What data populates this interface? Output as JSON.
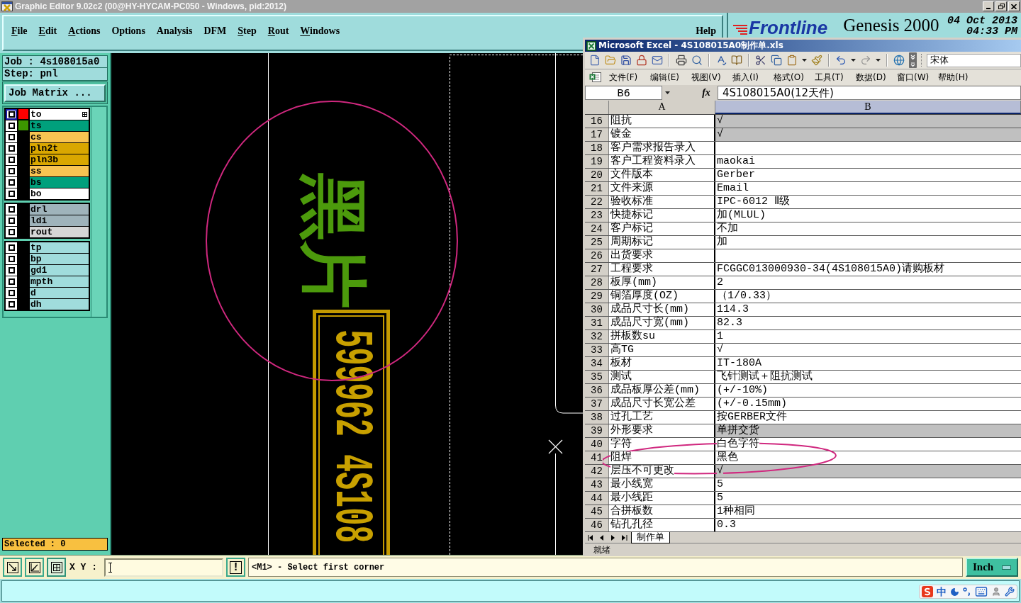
{
  "window": {
    "title": "Graphic Editor 9.02c2 (00@HY-HYCAM-PC050 - Windows, pid:2012)"
  },
  "menu": [
    {
      "label": "File",
      "mnemonic": true
    },
    {
      "label": "Edit",
      "mnemonic": true
    },
    {
      "label": "Actions",
      "mnemonic": true
    },
    {
      "label": "Options",
      "mnemonic": false
    },
    {
      "label": "Analysis",
      "mnemonic": false
    },
    {
      "label": "DFM",
      "mnemonic": false
    },
    {
      "label": "Step",
      "mnemonic": true
    },
    {
      "label": "Rout",
      "mnemonic": true
    },
    {
      "label": "Windows",
      "mnemonic": true
    },
    {
      "label": "Help",
      "mnemonic": false
    }
  ],
  "branding": {
    "logo": "Frontline",
    "product": "Genesis 2000",
    "date": "04 Oct 2013",
    "time": "04:33 PM"
  },
  "job": {
    "job_label": "Job : 4s108015a0",
    "step_label": "Step: pnl",
    "matrix_button": "Job Matrix ..."
  },
  "layer_groups": [
    {
      "layers": [
        {
          "name": "to",
          "color": "#ffffff",
          "swatch": {
            "color": "#ff0000"
          },
          "checked": true,
          "work_layer": true
        },
        {
          "name": "ts",
          "color": "#00a07c",
          "swatch": {
            "color": "#3c9600"
          },
          "checked": true,
          "work_layer": false
        },
        {
          "name": "cs",
          "color": "#f8c452",
          "checked": true,
          "work_layer": false
        },
        {
          "name": "pln2t",
          "color": "#d9a700",
          "checked": true,
          "work_layer": false
        },
        {
          "name": "pln3b",
          "color": "#d9a700",
          "checked": true,
          "work_layer": false
        },
        {
          "name": "ss",
          "color": "#f8c452",
          "checked": true,
          "work_layer": false
        },
        {
          "name": "bs",
          "color": "#00a07c",
          "checked": true,
          "work_layer": false
        },
        {
          "name": "bo",
          "color": "#ffffff",
          "checked": true,
          "work_layer": false
        }
      ]
    },
    {
      "layers": [
        {
          "name": "drl",
          "color": "#9fb3bb",
          "checked": true,
          "work_layer": false
        },
        {
          "name": "ldi",
          "color": "#9fb3bb",
          "checked": true,
          "work_layer": false
        },
        {
          "name": "rout",
          "color": "#d6d6d6",
          "checked": true,
          "work_layer": false
        }
      ]
    },
    {
      "layers": [
        {
          "name": "tp",
          "color": "#a0dcdc",
          "checked": true,
          "work_layer": false
        },
        {
          "name": "bp",
          "color": "#a0dcdc",
          "checked": true,
          "work_layer": false
        },
        {
          "name": "gd1",
          "color": "#a0dcdc",
          "checked": true,
          "work_layer": false
        },
        {
          "name": "mpth",
          "color": "#a0dcdc",
          "checked": true,
          "work_layer": false
        },
        {
          "name": "d",
          "color": "#a0dcdc",
          "checked": true,
          "work_layer": false
        },
        {
          "name": "dh",
          "color": "#a0dcdc",
          "checked": true,
          "work_layer": false
        }
      ]
    }
  ],
  "selection": {
    "label": "Selected : 0"
  },
  "canvas": {
    "silkscreen_text": "黑片",
    "serial_text": "599962 4S108"
  },
  "command_bar": {
    "xy_label": "X Y :",
    "alert_button": "!",
    "prompt": "<M1> - Select first corner",
    "units_button": "Inch"
  },
  "ime": {
    "mode": "中"
  },
  "excel": {
    "title": "Microsoft Excel - 4S108015A0制作单.xls",
    "font": "宋体",
    "menu": [
      "文件(F)",
      "编辑(E)",
      "视图(V)",
      "插入(I)",
      "格式(O)",
      "工具(T)",
      "数据(D)",
      "窗口(W)",
      "帮助(H)"
    ],
    "name_box": "B6",
    "function_button": "fx",
    "formula": "4S108015A0(12天件)",
    "columns": [
      {
        "label": "A",
        "selected": false
      },
      {
        "label": "B",
        "selected": true
      }
    ],
    "rows": [
      {
        "number": "16",
        "a": "阻抗",
        "b": "√",
        "shaded": true
      },
      {
        "number": "17",
        "a": "镀金",
        "b": "√",
        "shaded": true
      },
      {
        "number": "18",
        "a": "客户需求报告录入",
        "shaded": false
      },
      {
        "number": "19",
        "a": "客户工程资料录入",
        "b": "maokai",
        "shaded": false
      },
      {
        "number": "20",
        "a": "文件版本",
        "b": "Gerber",
        "shaded": false
      },
      {
        "number": "21",
        "a": "文件来源",
        "b": "Email",
        "shaded": false
      },
      {
        "number": "22",
        "a": "验收标准",
        "b": "IPC-6012 Ⅱ级",
        "shaded": false
      },
      {
        "number": "23",
        "a": "快捷标记",
        "b": "加(MLUL)",
        "shaded": false
      },
      {
        "number": "24",
        "a": "客户标记",
        "b": "不加",
        "shaded": false
      },
      {
        "number": "25",
        "a": "周期标记",
        "b": "加",
        "shaded": false
      },
      {
        "number": "26",
        "a": "出货要求",
        "shaded": false
      },
      {
        "number": "27",
        "a": "工程要求",
        "b": "FCGGC013000930-34(4S108015A0)请购板材",
        "shaded": false
      },
      {
        "number": "28",
        "a": "板厚(mm)",
        "b": "2",
        "shaded": false
      },
      {
        "number": "29",
        "a": "铜箔厚度(OZ)",
        "b": "（1/0.33）",
        "shaded": false
      },
      {
        "number": "30",
        "a": "成品尺寸长(mm)",
        "b": "114.3",
        "shaded": false
      },
      {
        "number": "31",
        "a": "成品尺寸宽(mm)",
        "b": "82.3",
        "shaded": false
      },
      {
        "number": "32",
        "a": "拼板数su",
        "b": "1",
        "shaded": false
      },
      {
        "number": "33",
        "a": "高TG",
        "b": "√",
        "shaded": false
      },
      {
        "number": "34",
        "a": "板材",
        "b": "IT-180A",
        "shaded": false
      },
      {
        "number": "35",
        "a": "测试",
        "b": "飞针测试＋阻抗测试",
        "shaded": false
      },
      {
        "number": "36",
        "a": "成品板厚公差(mm)",
        "b": "(+/-10%)",
        "shaded": false
      },
      {
        "number": "37",
        "a": "成品尺寸长宽公差",
        "b": "(+/-0.15mm)",
        "shaded": false
      },
      {
        "number": "38",
        "a": "过孔工艺",
        "b": "按GERBER文件",
        "shaded": false
      },
      {
        "number": "39",
        "a": "外形要求",
        "b": "单拼交货",
        "shaded": true
      },
      {
        "number": "40",
        "a": "字符",
        "b": "白色字符",
        "shaded": false
      },
      {
        "number": "41",
        "a": "阻焊",
        "b": "黑色",
        "shaded": false
      },
      {
        "number": "42",
        "a": "层压不可更改",
        "b": "√",
        "shaded": true
      },
      {
        "number": "43",
        "a": "最小线宽",
        "b": "5",
        "shaded": false
      },
      {
        "number": "44",
        "a": "最小线距",
        "b": "5",
        "shaded": false
      },
      {
        "number": "45",
        "a": "合拼板数",
        "b": "1种相同",
        "shaded": false
      },
      {
        "number": "46",
        "a": "钻孔孔径",
        "b": "0.3",
        "shaded": false
      }
    ],
    "sheet_tabs": [
      {
        "label": "制作单",
        "selected": true
      }
    ],
    "status": "就绪"
  }
}
